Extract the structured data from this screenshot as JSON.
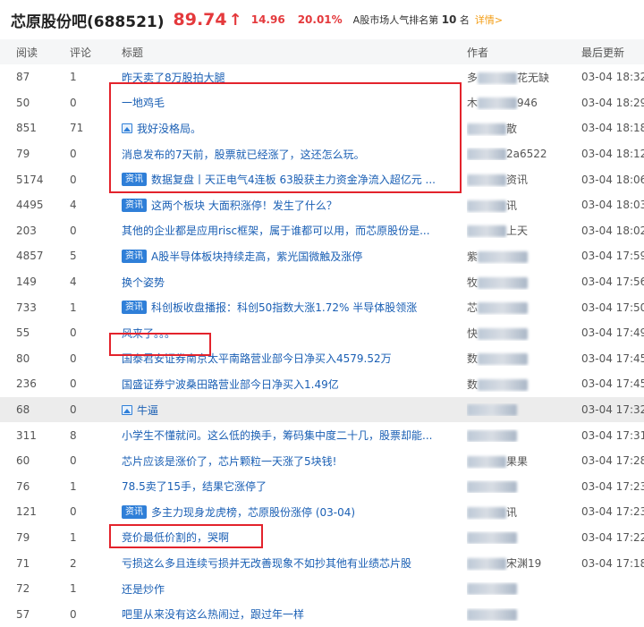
{
  "header": {
    "stock_name": "芯原股份吧(688521)",
    "price": "89.74",
    "arrow": "↑",
    "change": "14.96",
    "percent": "20.01%",
    "rank_prefix": "A股市场人气排名第",
    "rank_number": "10",
    "rank_suffix": "名",
    "detail_link": "详情>"
  },
  "columns": {
    "read": "阅读",
    "comment": "评论",
    "title": "标题",
    "author": "作者",
    "updated": "最后更新"
  },
  "rows": [
    {
      "read": "87",
      "comment": "1",
      "title": "昨天卖了8万股拍大腿",
      "badge": "",
      "author": "多",
      "author_tail": "花无缺",
      "time": "03-04 18:32"
    },
    {
      "read": "50",
      "comment": "0",
      "title": "一地鸡毛",
      "badge": "",
      "author": "木",
      "author_tail": "946",
      "time": "03-04 18:29"
    },
    {
      "read": "851",
      "comment": "71",
      "title": "我好没格局。",
      "badge": "",
      "image": true,
      "author": "",
      "author_tail": "散",
      "time": "03-04 18:18"
    },
    {
      "read": "79",
      "comment": "0",
      "title": "消息发布的7天前，股票就已经涨了，这还怎么玩。",
      "badge": "",
      "author": "",
      "author_tail": "2a6522",
      "time": "03-04 18:12"
    },
    {
      "read": "5174",
      "comment": "0",
      "title": "数据复盘丨天正电气4连板 63股获主力资金净流入超亿元 ...",
      "badge": "资讯",
      "author": "",
      "author_tail": "资讯",
      "time": "03-04 18:06"
    },
    {
      "read": "4495",
      "comment": "4",
      "title": "这两个板块 大面积涨停！发生了什么？",
      "badge": "资讯",
      "author": "",
      "author_tail": "讯",
      "time": "03-04 18:03"
    },
    {
      "read": "203",
      "comment": "0",
      "title": "其他的企业都是应用risc框架，属于谁都可以用，而芯原股份是...",
      "badge": "",
      "author": "",
      "author_tail": "上天",
      "time": "03-04 18:02"
    },
    {
      "read": "4857",
      "comment": "5",
      "title": "A股半导体板块持续走高，紫光国微触及涨停",
      "badge": "资讯",
      "author": "紫",
      "author_tail": "",
      "time": "03-04 17:59"
    },
    {
      "read": "149",
      "comment": "4",
      "title": "换个姿势",
      "badge": "",
      "author": "牧",
      "author_tail": "",
      "time": "03-04 17:56"
    },
    {
      "read": "733",
      "comment": "1",
      "title": "科创板收盘播报：科创50指数大涨1.72% 半导体股领涨",
      "badge": "资讯",
      "author": "芯",
      "author_tail": "",
      "time": "03-04 17:50"
    },
    {
      "read": "55",
      "comment": "0",
      "title": "风来了。。。",
      "badge": "",
      "author": "快",
      "author_tail": "",
      "time": "03-04 17:49"
    },
    {
      "read": "80",
      "comment": "0",
      "title": "国泰君安证券南京太平南路营业部今日净买入4579.52万",
      "badge": "",
      "author": "数",
      "author_tail": "",
      "time": "03-04 17:45"
    },
    {
      "read": "236",
      "comment": "0",
      "title": "国盛证券宁波桑田路营业部今日净买入1.49亿",
      "badge": "",
      "author": "数",
      "author_tail": "",
      "time": "03-04 17:45"
    },
    {
      "read": "68",
      "comment": "0",
      "title": "牛逼",
      "badge": "",
      "image": true,
      "author": "",
      "author_tail": "",
      "time": "03-04 17:32",
      "highlight": true
    },
    {
      "read": "311",
      "comment": "8",
      "title": "小学生不懂就问。这么低的换手，筹码集中度二十几，股票却能...",
      "badge": "",
      "author": "",
      "author_tail": "",
      "time": "03-04 17:31"
    },
    {
      "read": "60",
      "comment": "0",
      "title": "芯片应该是涨价了，芯片颗粒一天涨了5块钱!",
      "badge": "",
      "author": "",
      "author_tail": "果果",
      "time": "03-04 17:28"
    },
    {
      "read": "76",
      "comment": "1",
      "title": "78.5卖了15手，结果它涨停了",
      "badge": "",
      "author": "",
      "author_tail": "",
      "time": "03-04 17:23"
    },
    {
      "read": "121",
      "comment": "0",
      "title": "多主力现身龙虎榜，芯原股份涨停 (03-04)",
      "badge": "资讯",
      "author": "",
      "author_tail": "讯",
      "time": "03-04 17:23"
    },
    {
      "read": "79",
      "comment": "1",
      "title": "竞价最低价割的，哭啊",
      "badge": "",
      "author": "",
      "author_tail": "",
      "time": "03-04 17:22"
    },
    {
      "read": "71",
      "comment": "2",
      "title": "亏损这么多且连续亏损并无改善现象不如抄其他有业绩芯片股",
      "badge": "",
      "author": "",
      "author_tail": "宋渊19",
      "time": "03-04 17:18"
    },
    {
      "read": "72",
      "comment": "1",
      "title": "还是炒作",
      "badge": "",
      "author": "",
      "author_tail": "",
      "time": ""
    },
    {
      "read": "57",
      "comment": "0",
      "title": "吧里从来没有这么热闹过，跟过年一样",
      "badge": "",
      "author": "",
      "author_tail": "",
      "time": ""
    }
  ],
  "colors": {
    "price_red": "#e4393c",
    "link_blue": "#1a5fb4",
    "badge_blue": "#2f7fd8",
    "box_red": "#e3232c",
    "detail_orange": "#f39c12"
  }
}
